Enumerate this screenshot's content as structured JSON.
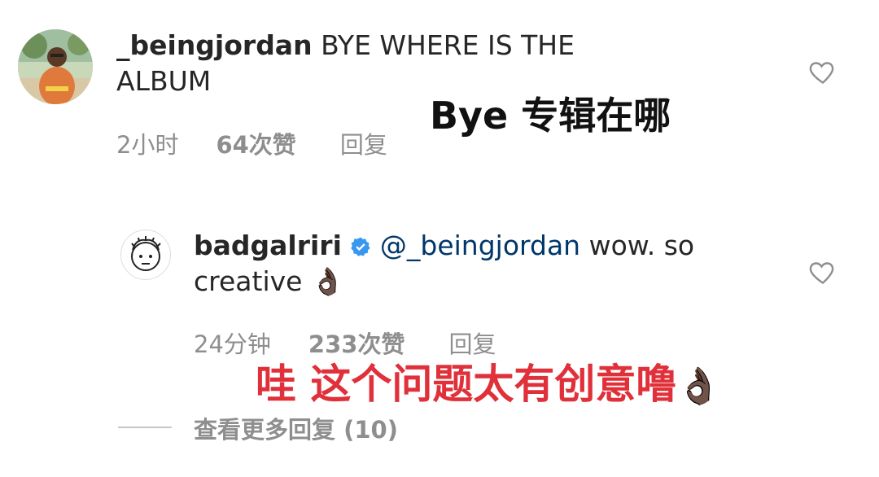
{
  "comments": [
    {
      "username": "_beingjordan",
      "text_line1": "BYE WHERE IS THE",
      "text_line2": "ALBUM",
      "time": "2小时",
      "likes": "64次赞",
      "reply": "回复"
    },
    {
      "username": "badgalriri",
      "verified": true,
      "mention": "@_beingjordan",
      "text_line1": "wow. so",
      "text_line2": "creative",
      "emoji": "👌🏿",
      "time": "24分钟",
      "likes": "233次赞",
      "reply": "回复"
    }
  ],
  "overlays": {
    "caption1": "Bye 专辑在哪",
    "caption2": "哇 这个问题太有创意噜",
    "caption2_emoji": "👌🏿",
    "caption1_color": "#111111",
    "caption2_color": "#e0303a"
  },
  "view_more": {
    "label": "查看更多回复",
    "count": "(10)"
  },
  "colors": {
    "text": "#262626",
    "muted": "#8e8e8e",
    "mention": "#00376b",
    "verified": "#3897f0"
  }
}
